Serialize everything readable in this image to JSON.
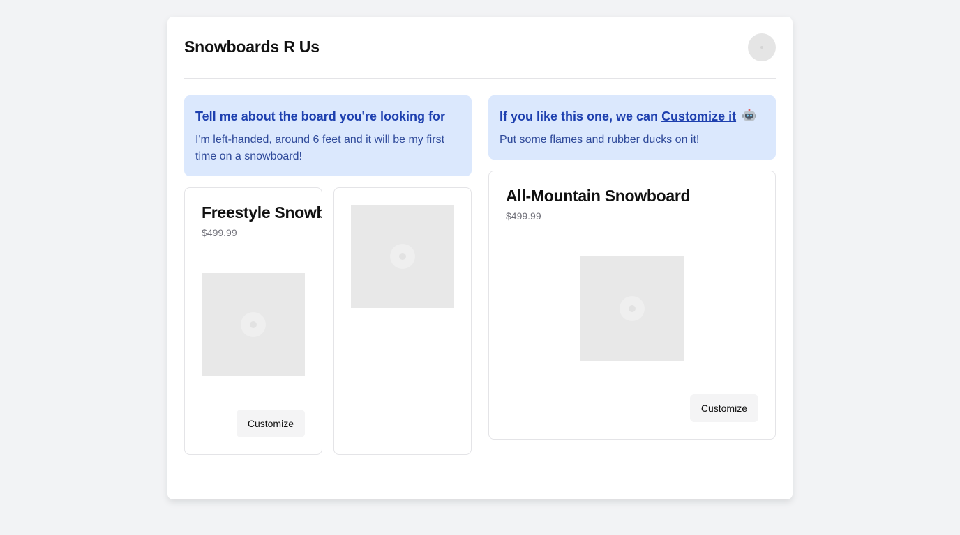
{
  "app": {
    "title": "Snowboards R Us"
  },
  "left": {
    "bubble": {
      "title": "Tell me about the board you're looking for",
      "body": "I'm left-handed, around 6 feet and it will be my first time on a snowboard!"
    },
    "products": [
      {
        "name": "Freestyle Snowboard",
        "price": "$499.99",
        "button": "Customize"
      }
    ]
  },
  "right": {
    "bubble": {
      "title_prefix": "If you like this one, we can ",
      "link": "Customize it",
      "icon": "robot-icon",
      "body": "Put some flames and rubber ducks on it!"
    },
    "product": {
      "name": "All-Mountain Snowboard",
      "price": "$499.99",
      "button": "Customize"
    }
  },
  "colors": {
    "bubble_bg": "#dbe8fd",
    "bubble_text": "#1e40af",
    "placeholder": "#e8e8e8"
  }
}
